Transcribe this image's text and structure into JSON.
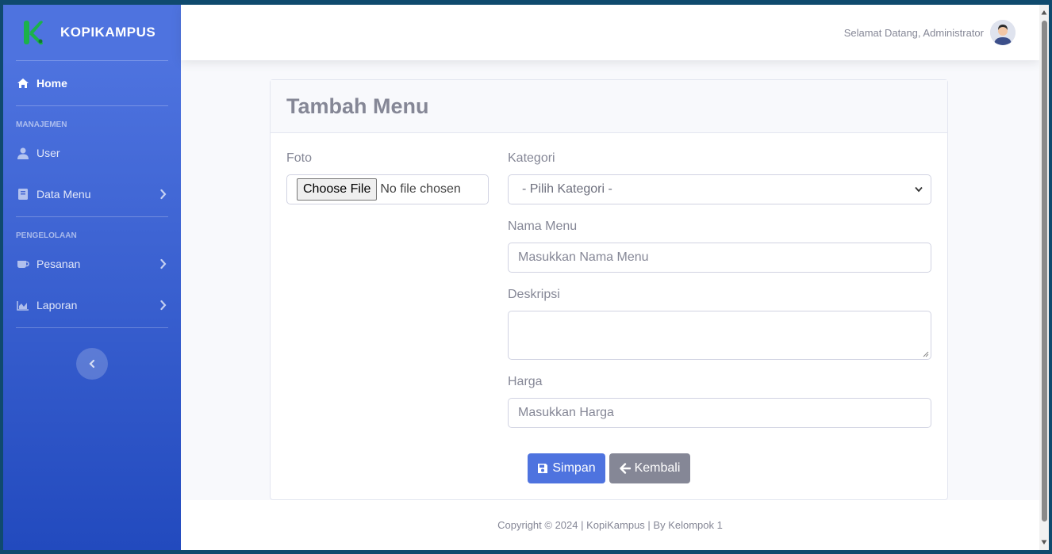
{
  "brand": {
    "name": "KOPIKAMPUS"
  },
  "sidebar": {
    "home": "Home",
    "section_manage": "MANAJEMEN",
    "user": "User",
    "data_menu": "Data Menu",
    "section_process": "PENGELOLAAN",
    "orders": "Pesanan",
    "reports": "Laporan"
  },
  "topbar": {
    "greeting": "Selamat Datang, Administrator"
  },
  "form": {
    "title": "Tambah Menu",
    "photo_label": "Foto",
    "choose_file": "Choose File",
    "no_file": "No file chosen",
    "category_label": "Kategori",
    "category_selected": "- Pilih Kategori -",
    "name_label": "Nama Menu",
    "name_placeholder": "Masukkan Nama Menu",
    "desc_label": "Deskripsi",
    "price_label": "Harga",
    "price_placeholder": "Masukkan Harga",
    "save": "Simpan",
    "back": "Kembali"
  },
  "footer": {
    "copyright": "Copyright © 2024 | KopiKampus | By Kelompok 1"
  },
  "colors": {
    "primary": "#4e73df",
    "secondary": "#858796",
    "logo_green": "#1bb24a"
  }
}
